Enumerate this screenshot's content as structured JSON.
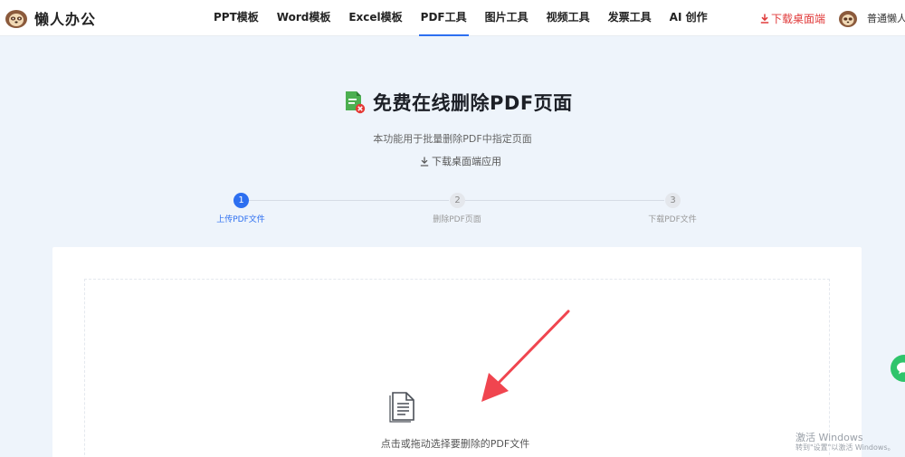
{
  "brand": {
    "name": "懒人办公",
    "logo_icon": "sloth-mascot-icon"
  },
  "nav": {
    "items": [
      {
        "label": "PPT模板",
        "active": false
      },
      {
        "label": "Word模板",
        "active": false
      },
      {
        "label": "Excel模板",
        "active": false
      },
      {
        "label": "PDF工具",
        "active": true
      },
      {
        "label": "图片工具",
        "active": false
      },
      {
        "label": "视频工具",
        "active": false
      },
      {
        "label": "发票工具",
        "active": false
      },
      {
        "label": "AI 创作",
        "active": false
      }
    ],
    "active_color": "#2d6ff0"
  },
  "header": {
    "download_label": "下载桌面端",
    "download_color": "#e03a3a",
    "user_name": "普通懒人"
  },
  "hero": {
    "title": "免费在线删除PDF页面",
    "subtitle": "本功能用于批量删除PDF中指定页面",
    "download_app_label": "下载桌面端应用"
  },
  "steps": [
    {
      "number": "1",
      "label": "上传PDF文件",
      "active": true
    },
    {
      "number": "2",
      "label": "删除PDF页面",
      "active": false
    },
    {
      "number": "3",
      "label": "下载PDF文件",
      "active": false
    }
  ],
  "upload": {
    "prompt": "点击或拖动选择要删除的PDF文件",
    "icon": "document-icon"
  },
  "watermark": {
    "line1": "激活 Windows",
    "line2": "转到\"设置\"以激活 Windows。"
  },
  "colors": {
    "accent": "#2d6ff0",
    "arrow": "#f0454f",
    "float": "#2fc46b"
  }
}
